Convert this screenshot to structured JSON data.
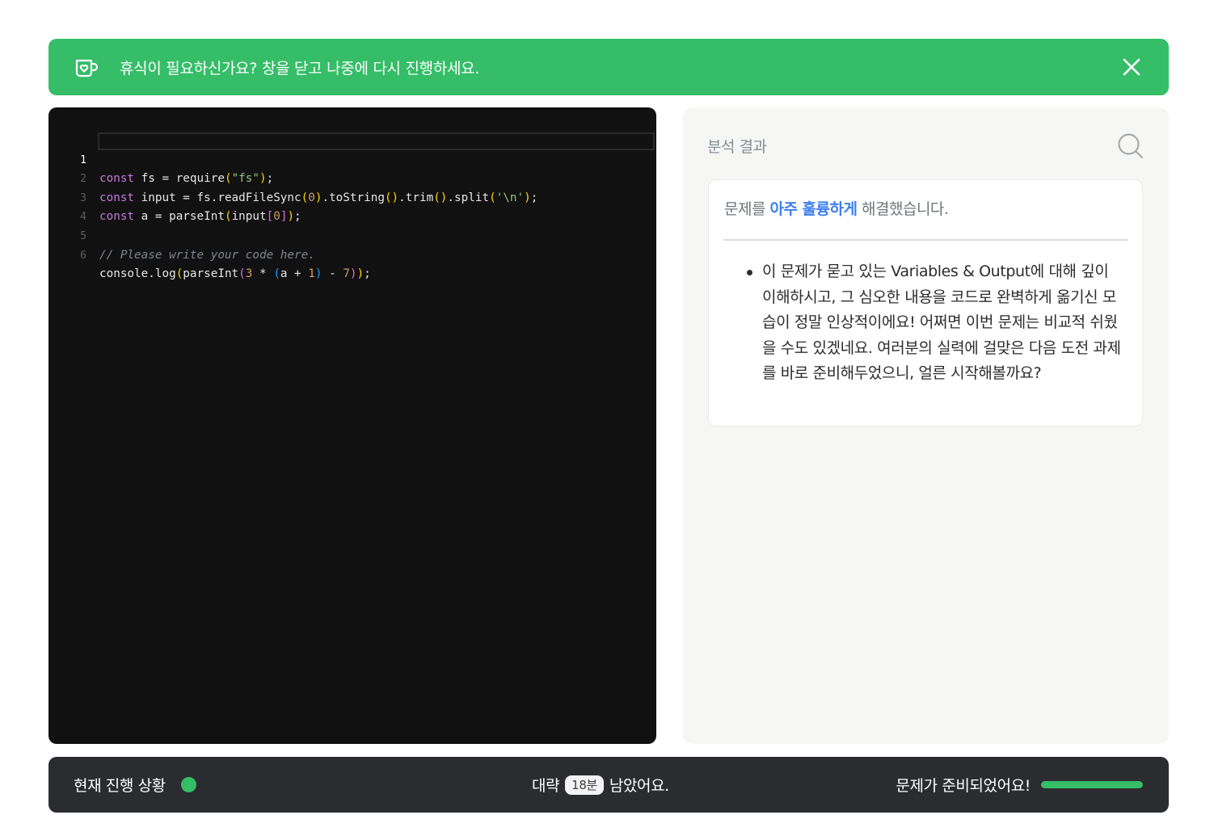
{
  "banner": {
    "icon": "coffee-mug-heart-icon",
    "message": "휴식이 필요하신가요? 창을 닫고 나중에 다시 진행하세요.",
    "close_icon": "close-icon",
    "color": "#35bd67"
  },
  "editor": {
    "active_line": 1,
    "lines": [
      {
        "num": "1",
        "code": "const fs = require(\"fs\");"
      },
      {
        "num": "2",
        "code": "const input = fs.readFileSync(0).toString().trim().split('\\n');"
      },
      {
        "num": "3",
        "code": "const a = parseInt(input[0]);"
      },
      {
        "num": "4",
        "code": ""
      },
      {
        "num": "5",
        "code": "// Please write your code here."
      },
      {
        "num": "6",
        "code": "console.log(parseInt(3 * (a + 1) - 7));"
      }
    ]
  },
  "analysis": {
    "title": "분석 결과",
    "search_icon": "search-icon",
    "headline_prefix": "문제를 ",
    "headline_emphasis": "아주 훌륭하게",
    "headline_suffix": " 해결했습니다.",
    "feedback": [
      "이 문제가 묻고 있는 Variables & Output에 대해 깊이 이해하시고, 그 심오한 내용을 코드로 완벽하게 옮기신 모습이 정말 인상적이에요! 어쩌면 이번 문제는 비교적 쉬웠을 수도 있겠네요. 여러분의 실력에 걸맞은 다음 도전 과제를 바로 준비해두었으니, 얼른 시작해볼까요?"
    ],
    "accent_color": "#3d7ff0"
  },
  "status": {
    "label": "현재 진행 상황",
    "time_prefix": "대략",
    "time_value": "18분",
    "time_suffix": "남았어요.",
    "ready_text": "문제가 준비되었어요!",
    "progress": 1.0,
    "progress_color": "#35bd67"
  }
}
